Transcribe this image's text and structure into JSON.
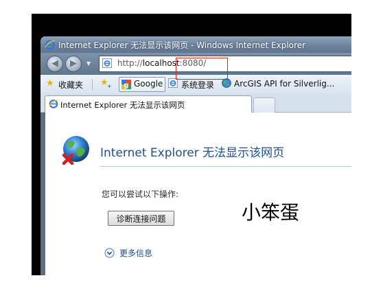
{
  "window": {
    "title": "Internet Explorer 无法显示该网页 - Windows Internet Explorer"
  },
  "address_bar": {
    "url_prefix": "http://",
    "url_host": "localhost",
    "url_rest": ":8080/"
  },
  "favorites_bar": {
    "favorites_label": "收藏夹",
    "items": [
      {
        "label": "Google",
        "icon": "google-icon"
      },
      {
        "label": "系统登录",
        "icon": "ie-page-icon"
      },
      {
        "label": "ArcGIS API for Silverlig...",
        "icon": "arcgis-globe-icon"
      }
    ]
  },
  "tabs": [
    {
      "label": "Internet Explorer 无法显示该网页",
      "active": true
    }
  ],
  "error_page": {
    "heading": "Internet Explorer 无法显示该网页",
    "hint": "您可以尝试以下操作:",
    "diagnose_button": "诊断连接问题",
    "more_info": "更多信息"
  },
  "annotation": {
    "text": "小笨蛋"
  },
  "colors": {
    "heading_blue": "#1f4e93",
    "annotation_box": "#e02020",
    "frame": "#000000"
  }
}
